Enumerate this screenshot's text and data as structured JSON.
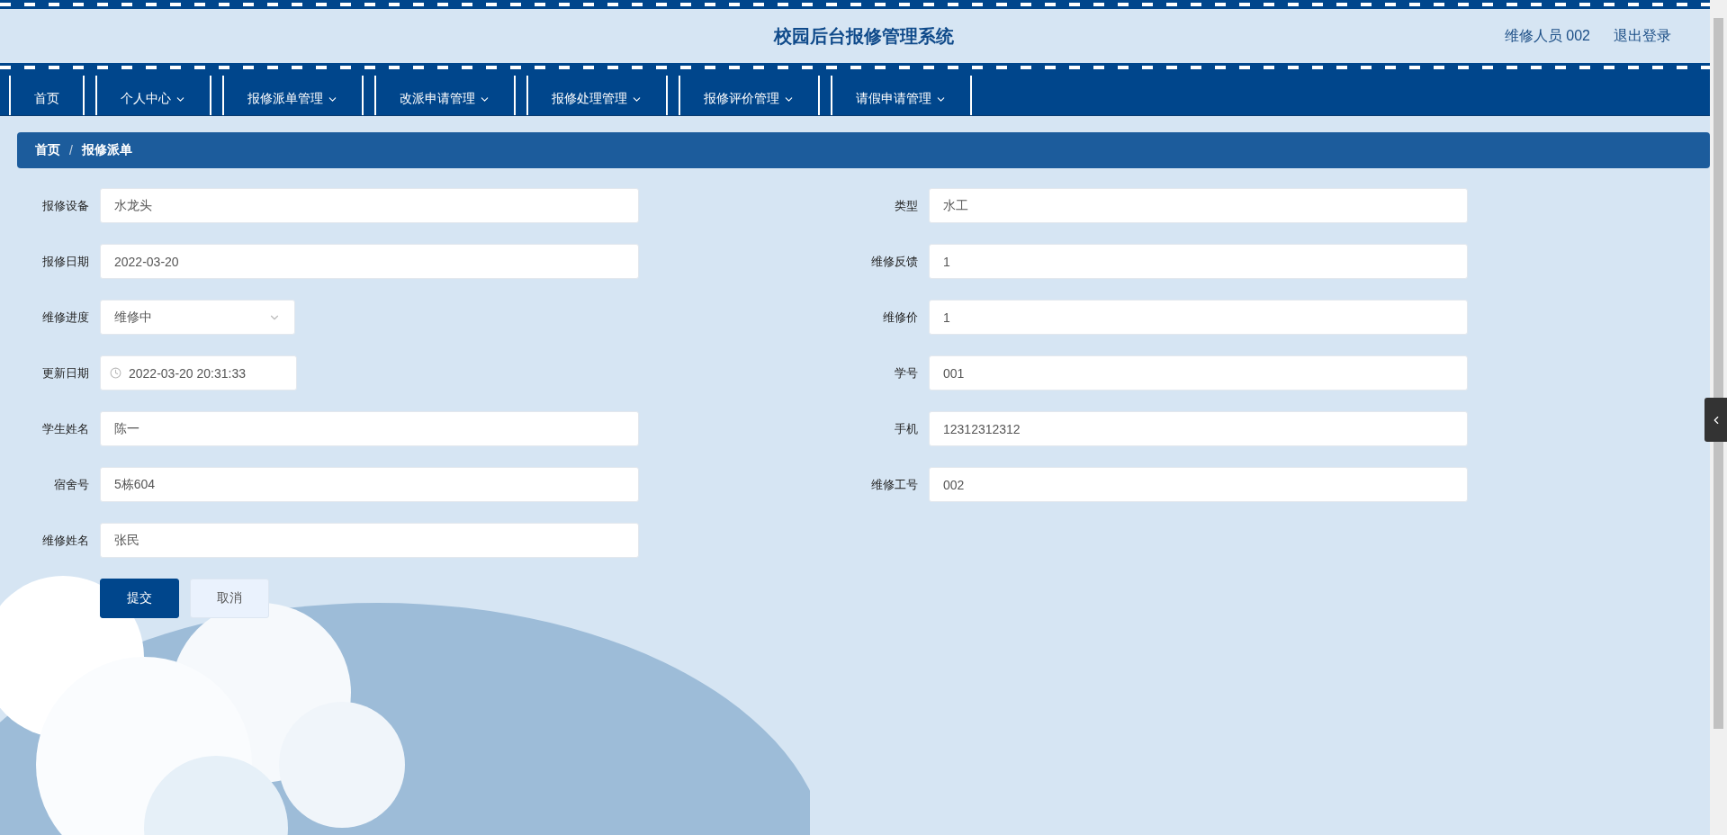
{
  "header": {
    "title": "校园后台报修管理系统",
    "user": "维修人员 002",
    "logout": "退出登录"
  },
  "nav": [
    {
      "label": "首页",
      "dropdown": false,
      "selected": false
    },
    {
      "label": "个人中心",
      "dropdown": true,
      "selected": false
    },
    {
      "label": "报修派单管理",
      "dropdown": true,
      "selected": false
    },
    {
      "label": "改派申请管理",
      "dropdown": true,
      "selected": false
    },
    {
      "label": "报修处理管理",
      "dropdown": true,
      "selected": false
    },
    {
      "label": "报修评价管理",
      "dropdown": true,
      "selected": false
    },
    {
      "label": "请假申请管理",
      "dropdown": true,
      "selected": false
    }
  ],
  "breadcrumb": {
    "separator": "/",
    "items": [
      "首页",
      "报修派单"
    ]
  },
  "form": {
    "left": [
      {
        "label": "报修设备",
        "kind": "text",
        "value": "水龙头"
      },
      {
        "label": "报修日期",
        "kind": "text",
        "value": "2022-03-20"
      },
      {
        "label": "维修进度",
        "kind": "select",
        "value": "维修中"
      },
      {
        "label": "更新日期",
        "kind": "datetime",
        "value": "2022-03-20 20:31:33"
      },
      {
        "label": "学生姓名",
        "kind": "text",
        "value": "陈一"
      },
      {
        "label": "宿舍号",
        "kind": "text",
        "value": "5栋604"
      },
      {
        "label": "维修姓名",
        "kind": "text",
        "value": "张民"
      }
    ],
    "right": [
      {
        "label": "类型",
        "kind": "text",
        "value": "水工"
      },
      {
        "label": "维修反馈",
        "kind": "text",
        "value": "1"
      },
      {
        "label": "维修价",
        "kind": "text",
        "value": "1"
      },
      {
        "label": "学号",
        "kind": "text",
        "value": "001"
      },
      {
        "label": "手机",
        "kind": "text",
        "value": "12312312312"
      },
      {
        "label": "维修工号",
        "kind": "text",
        "value": "002"
      }
    ]
  },
  "buttons": [
    {
      "label": "提交",
      "kind": "primary"
    },
    {
      "label": "取消",
      "kind": "secondary"
    }
  ]
}
